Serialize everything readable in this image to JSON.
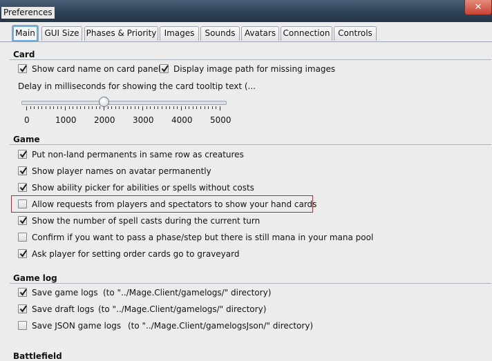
{
  "window": {
    "title": "Preferences",
    "close_glyph": "✕"
  },
  "tabs": [
    {
      "label": "Main",
      "active": true
    },
    {
      "label": "GUI Size"
    },
    {
      "label": "Phases & Priority"
    },
    {
      "label": "Images"
    },
    {
      "label": "Sounds"
    },
    {
      "label": "Avatars"
    },
    {
      "label": "Connection"
    },
    {
      "label": "Controls"
    }
  ],
  "card_section": {
    "title": "Card",
    "options": [
      {
        "label": "Show card name on card panel",
        "checked": true
      },
      {
        "label": "Display image path for missing images",
        "checked": true
      }
    ],
    "tooltip_delay": {
      "label": "Delay in milliseconds for showing the card tooltip text (...",
      "value": 2000,
      "min": 0,
      "max": 5000,
      "ticks": [
        "0",
        "1000",
        "2000",
        "3000",
        "4000",
        "5000"
      ]
    }
  },
  "game_section": {
    "title": "Game",
    "options": [
      {
        "label": "Put non-land permanents in same row as creatures",
        "checked": true
      },
      {
        "label": "Show player names on avatar permanently",
        "checked": true
      },
      {
        "label": "Show ability picker for abilities or spells without costs",
        "checked": true
      },
      {
        "label": "Allow requests from players and spectators to show your hand cards",
        "checked": false,
        "highlighted": true
      },
      {
        "label": "Show the number of spell casts during the current turn",
        "checked": true
      },
      {
        "label": "Confirm if you want to pass a phase/step but there is still mana in your mana pool",
        "checked": false
      },
      {
        "label": "Ask player for setting order cards go to graveyard",
        "checked": true
      }
    ]
  },
  "gamelog_section": {
    "title": "Game log",
    "options": [
      {
        "label": "Save game logs",
        "note": "(to \"../Mage.Client/gamelogs/\" directory)",
        "checked": true
      },
      {
        "label": "Save draft logs",
        "note": "(to \"../Mage.Client/gamelogs/\" directory)",
        "checked": true
      },
      {
        "label": "Save JSON game logs",
        "note": "(to \"../Mage.Client/gamelogsJson/\" directory)",
        "checked": false
      }
    ]
  },
  "battlefield_section": {
    "title": "Battlefield"
  },
  "colors": {
    "highlight_border": "#d01d1d",
    "active_tab_glow": "#66aee5",
    "close_button": "#c74231"
  }
}
